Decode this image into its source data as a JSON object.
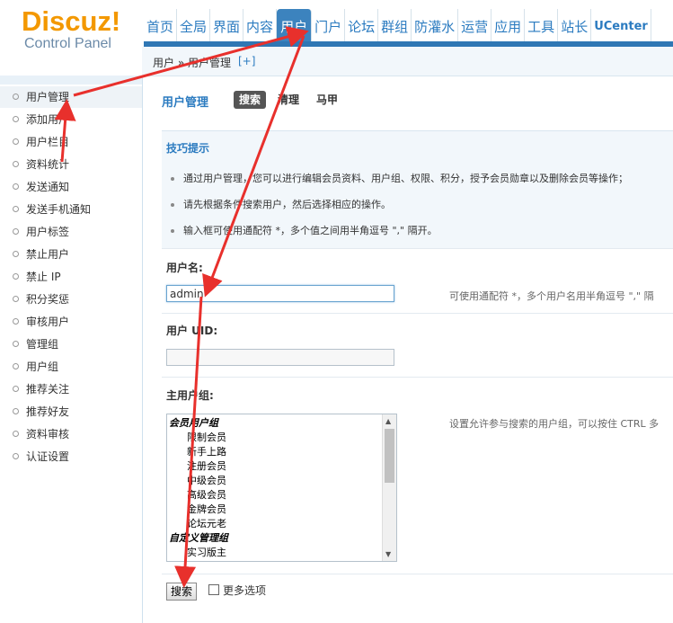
{
  "logo": {
    "main": "Discuz",
    "bang": "!",
    "sub": "Control Panel"
  },
  "topnav": [
    "首页",
    "全局",
    "界面",
    "内容",
    "用户",
    "门户",
    "论坛",
    "群组",
    "防灌水",
    "运营",
    "应用",
    "工具",
    "站长",
    "UCenter"
  ],
  "topnav_active": "用户",
  "breadcrumb": {
    "text": "用户 » 用户管理",
    "add": "[+]"
  },
  "sidebar": {
    "items": [
      "用户管理",
      "添加用户",
      "用户栏目",
      "资料统计",
      "发送通知",
      "发送手机通知",
      "用户标签",
      "禁止用户",
      "禁止 IP",
      "积分奖惩",
      "审核用户",
      "管理组",
      "用户组",
      "推荐关注",
      "推荐好友",
      "资料审核",
      "认证设置"
    ]
  },
  "page": {
    "title": "用户管理",
    "tabs": [
      "搜索",
      "清理",
      "马甲"
    ]
  },
  "tips": {
    "title": "技巧提示",
    "items": [
      "通过用户管理，您可以进行编辑会员资料、用户组、权限、积分，授予会员勋章以及删除会员等操作；",
      "请先根据条件搜索用户，然后选择相应的操作。",
      "输入框可使用通配符 *，多个值之间用半角逗号 \",\" 隔开。"
    ]
  },
  "form": {
    "username_label": "用户名:",
    "username_value": "admin",
    "username_hint": "可使用通配符 *，多个用户名用半角逗号 \",\" 隔",
    "uid_label": "用户 UID:",
    "uid_value": "",
    "group_label": "主用户组:",
    "group_hint": "设置允许参与搜索的用户组，可以按住 CTRL 多",
    "group_options": [
      {
        "text": "会员用户组",
        "type": "head"
      },
      {
        "text": "限制会员",
        "type": "sub"
      },
      {
        "text": "新手上路",
        "type": "sub"
      },
      {
        "text": "注册会员",
        "type": "sub"
      },
      {
        "text": "中级会员",
        "type": "sub"
      },
      {
        "text": "高级会员",
        "type": "sub"
      },
      {
        "text": "金牌会员",
        "type": "sub"
      },
      {
        "text": "论坛元老",
        "type": "sub"
      },
      {
        "text": "自定义管理组",
        "type": "head"
      },
      {
        "text": "实习版主",
        "type": "sub"
      }
    ],
    "search_button": "搜索",
    "more_options": "更多选项"
  },
  "colors": {
    "accent": "#2f77b4",
    "logo": "#f39800",
    "annotation_arrow": "#e8302c"
  }
}
